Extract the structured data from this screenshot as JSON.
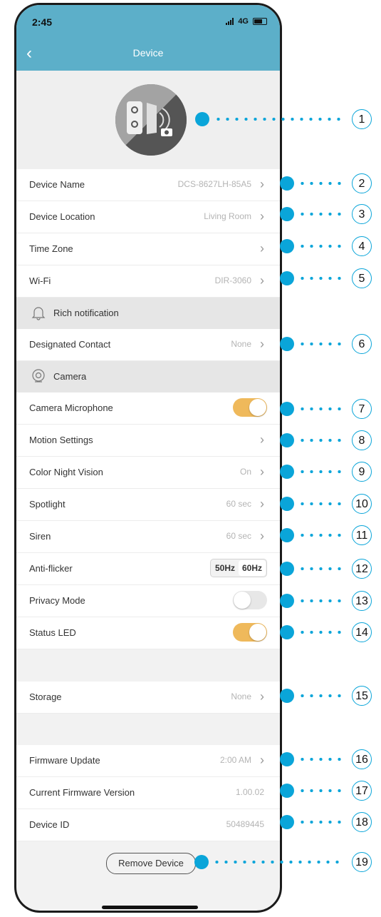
{
  "status_bar": {
    "time": "2:45",
    "network": "4G"
  },
  "header": {
    "title": "Device"
  },
  "rows": {
    "device_name": {
      "label": "Device Name",
      "value": "DCS-8627LH-85A5"
    },
    "device_location": {
      "label": "Device Location",
      "value": "Living Room"
    },
    "time_zone": {
      "label": "Time Zone",
      "value": ""
    },
    "wifi": {
      "label": "Wi-Fi",
      "value": "DIR-3060"
    },
    "designated_contact": {
      "label": "Designated Contact",
      "value": "None"
    },
    "camera_microphone": {
      "label": "Camera Microphone",
      "on": true
    },
    "motion_settings": {
      "label": "Motion Settings",
      "value": ""
    },
    "color_night_vision": {
      "label": "Color Night Vision",
      "value": "On"
    },
    "spotlight": {
      "label": "Spotlight",
      "value": "60 sec"
    },
    "siren": {
      "label": "Siren",
      "value": "60 sec"
    },
    "anti_flicker": {
      "label": "Anti-flicker",
      "options": [
        "50Hz",
        "60Hz"
      ],
      "selected": "60Hz"
    },
    "privacy_mode": {
      "label": "Privacy Mode",
      "on": false
    },
    "status_led": {
      "label": "Status LED",
      "on": true
    },
    "storage": {
      "label": "Storage",
      "value": "None"
    },
    "firmware_update": {
      "label": "Firmware Update",
      "value": "2:00 AM"
    },
    "firmware_version": {
      "label": "Current Firmware Version",
      "value": "1.00.02"
    },
    "device_id": {
      "label": "Device ID",
      "value": "50489445"
    }
  },
  "sections": {
    "rich_notification": {
      "label": "Rich notification",
      "icon": "bell-icon"
    },
    "camera": {
      "label": "Camera",
      "icon": "camera-icon"
    }
  },
  "remove_button": {
    "label": "Remove Device"
  },
  "callouts": [
    "1",
    "2",
    "3",
    "4",
    "5",
    "6",
    "7",
    "8",
    "9",
    "10",
    "11",
    "12",
    "13",
    "14",
    "15",
    "16",
    "17",
    "18",
    "19"
  ],
  "colors": {
    "header": "#5cafc9",
    "toggle_on": "#efb95b",
    "callout": "#0aa5d9"
  }
}
